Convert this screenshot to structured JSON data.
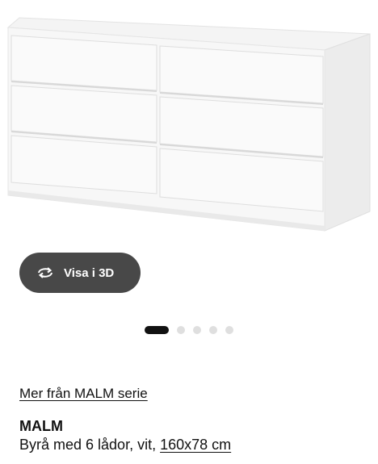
{
  "product_image": {
    "alt": "MALM",
    "icon": "dresser-icon"
  },
  "view3d": {
    "label": "Visa i 3D",
    "icon": "rotate-3d-icon"
  },
  "carousel": {
    "count": 5,
    "active_index": 0
  },
  "series_link": "Mer från MALM serie",
  "product": {
    "name": "MALM",
    "description": "Byrå med 6 lådor, vit, ",
    "size": "160x78 cm"
  },
  "colors": {
    "button_bg": "#484848",
    "dot_active": "#111111",
    "dot_inactive": "#dfdfdf"
  }
}
